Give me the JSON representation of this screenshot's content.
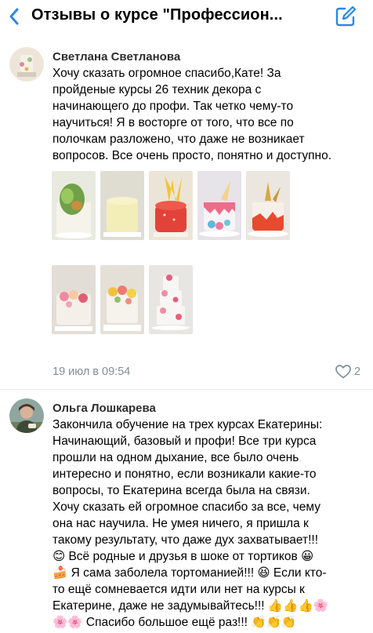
{
  "header": {
    "title": "Отзывы о курсе \"Профессион...",
    "accent": "#2688eb"
  },
  "comments": [
    {
      "author": "Светлана Светланова",
      "lines": [
        "Хочу сказать огромное спасибо,Кате! За",
        "пройденые курсы 26 техник декора с",
        "начинающего до профи. Так четко чему-то",
        "научиться! Я в восторге от того, что все по",
        "полочкам разложено, что даже не возникает",
        "вопросов. Все очень просто, понятно и доступно."
      ],
      "photo_count": 8,
      "time": "19 июл в 09:54",
      "likes": "2"
    },
    {
      "author": "Ольга Лошкарева",
      "lines": [
        "Закончила обучение на трех курсах Екатерины:",
        "Начинающий, базовый и профи! Все три курса",
        "прошли на одном дыхание, все было очень",
        "интересно и понятно, если возникали какие-то",
        "вопросы, то Екатерина всегда была на связи.",
        "Хочу сказать ей огромное спасибо за все, чему",
        "она нас научила. Не умея ничего, я пришла к",
        "такому результату, что даже дух захватывает!!!",
        "😊 Всё родные и друзья в шоке от тортиков 😀",
        "🍰 Я сама заболела тортоманией!!! 😆 Если кто-",
        "то ещё сомневается идти или нет на курсы к",
        "Екатерине, даже не задумывайтесь!!! 👍👍👍🌸",
        "🌸🌸 Спасибо большое ещё раз!!! 👏👏👏"
      ]
    }
  ]
}
